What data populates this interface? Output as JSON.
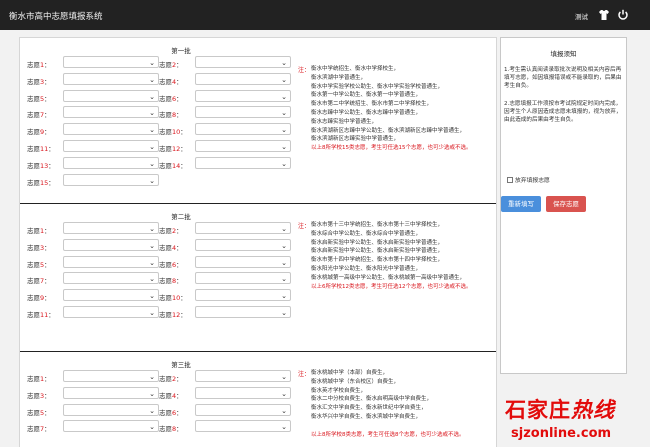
{
  "topbar": {
    "title": "衡水市高中志愿填报系统",
    "user": "测试"
  },
  "icons": [
    "shirt-icon",
    "power-icon",
    "chevron-down-icon"
  ],
  "batches": [
    {
      "title": "第一批",
      "fields": [
        {
          "prefix": "志愿",
          "num": "1",
          "suffix": "："
        },
        {
          "prefix": "志愿",
          "num": "2",
          "suffix": "："
        },
        {
          "prefix": "志愿",
          "num": "3",
          "suffix": "："
        },
        {
          "prefix": "志愿",
          "num": "4",
          "suffix": "："
        },
        {
          "prefix": "志愿",
          "num": "5",
          "suffix": "："
        },
        {
          "prefix": "志愿",
          "num": "6",
          "suffix": "："
        },
        {
          "prefix": "志愿",
          "num": "7",
          "suffix": "："
        },
        {
          "prefix": "志愿",
          "num": "8",
          "suffix": "："
        },
        {
          "prefix": "志愿",
          "num": "9",
          "suffix": "："
        },
        {
          "prefix": "志愿",
          "num": "10",
          "suffix": "："
        },
        {
          "prefix": "志愿",
          "num": "11",
          "suffix": "："
        },
        {
          "prefix": "志愿",
          "num": "12",
          "suffix": "："
        },
        {
          "prefix": "志愿",
          "num": "13",
          "suffix": "："
        },
        {
          "prefix": "志愿",
          "num": "14",
          "suffix": "："
        },
        {
          "prefix": "志愿",
          "num": "15",
          "suffix": "："
        }
      ],
      "note_head": "注：",
      "notes": [
        "衡水中学统招生、衡水中学择校生，",
        "衡水滨湖中学普通生，",
        "衡水中学实验学校公助生、衡水中学实验学校普通生，",
        "衡水第一中学公助生、衡水第一中学普通生，",
        "衡水市第二中学统招生、衡水市第二中学择校生，",
        "衡水志臻中学公助生、衡水志臻中学普通生，",
        "衡水志臻实验中学普通生，",
        "衡水滨湖新区志臻中学公助生、衡水滨湖新区志臻中学普通生，",
        "衡水滨湖新区志臻实验中学普通生，",
        "以上8所学校15类志愿，考生可任选15个志愿，也可少选或不选。"
      ]
    },
    {
      "title": "第二批",
      "fields": [
        {
          "prefix": "志愿",
          "num": "1",
          "suffix": "："
        },
        {
          "prefix": "志愿",
          "num": "2",
          "suffix": "："
        },
        {
          "prefix": "志愿",
          "num": "3",
          "suffix": "："
        },
        {
          "prefix": "志愿",
          "num": "4",
          "suffix": "："
        },
        {
          "prefix": "志愿",
          "num": "5",
          "suffix": "："
        },
        {
          "prefix": "志愿",
          "num": "6",
          "suffix": "："
        },
        {
          "prefix": "志愿",
          "num": "7",
          "suffix": "："
        },
        {
          "prefix": "志愿",
          "num": "8",
          "suffix": "："
        },
        {
          "prefix": "志愿",
          "num": "9",
          "suffix": "："
        },
        {
          "prefix": "志愿",
          "num": "10",
          "suffix": "："
        },
        {
          "prefix": "志愿",
          "num": "11",
          "suffix": "："
        },
        {
          "prefix": "志愿",
          "num": "12",
          "suffix": "："
        }
      ],
      "note_head": "注：",
      "notes": [
        "衡水市第十三中学统招生、衡水市第十三中学择校生，",
        "衡水综合中学公助生、衡水综合中学普通生，",
        "衡水启新实验中学公助生、衡水启新实验中学普通生，",
        "衡水启新实验中学公助生、衡水启新实验中学普通生，",
        "衡水市第十四中学统招生、衡水市第十四中学择校生，",
        "衡水阳光中学公助生、衡水阳光中学普通生，",
        "衡水桃城第一高级中学公助生、衡水桃城第一高级中学普通生，",
        "以上6所学校12类志愿，考生可任选12个志愿，也可少选或不选。"
      ]
    },
    {
      "title": "第三批",
      "fields": [
        {
          "prefix": "志愿",
          "num": "1",
          "suffix": "："
        },
        {
          "prefix": "志愿",
          "num": "2",
          "suffix": "："
        },
        {
          "prefix": "志愿",
          "num": "3",
          "suffix": "："
        },
        {
          "prefix": "志愿",
          "num": "4",
          "suffix": "："
        },
        {
          "prefix": "志愿",
          "num": "5",
          "suffix": "："
        },
        {
          "prefix": "志愿",
          "num": "6",
          "suffix": "："
        },
        {
          "prefix": "志愿",
          "num": "7",
          "suffix": "："
        },
        {
          "prefix": "志愿",
          "num": "8",
          "suffix": "："
        }
      ],
      "note_head": "注：",
      "notes": [
        "衡水桃城中学（本部）自费生，",
        "衡水桃城中学（东合校区）自费生，",
        "衡水英才学校自费生，",
        "衡水二中分校自费生、衡水启明高级中学自费生，",
        "衡水汇文中学自费生、衡水新世纪中学自费生，",
        "衡水华兴中学自费生、衡水滨城中学自费生，",
        "",
        "以上8所学校8类志愿，考生可任选8个志愿，也可少选或不选。"
      ]
    }
  ],
  "side": {
    "title": "填报须知",
    "para1": "1.考生需认真阅读录取批次说明及相关内容后再填写志愿，如因填报错误或不能录取的，后果由考生自负。",
    "para2": "2.志愿填报工作须按市考试院规定时间内完成，因考生个人原因造成志愿未填报的，视为放弃，由此造成的后果由考生自负。",
    "agree_label": "放弃填报志愿",
    "btn_reset": "重新填写",
    "btn_save": "保存志愿"
  },
  "watermark": {
    "text": "石家庄",
    "hot": "热线",
    "url": "sjzonline.com"
  },
  "colors": {
    "topbar": "#222222",
    "accent_red": "#d9141b",
    "btn_blue": "#4a8fdc",
    "btn_red": "#d9534f"
  }
}
